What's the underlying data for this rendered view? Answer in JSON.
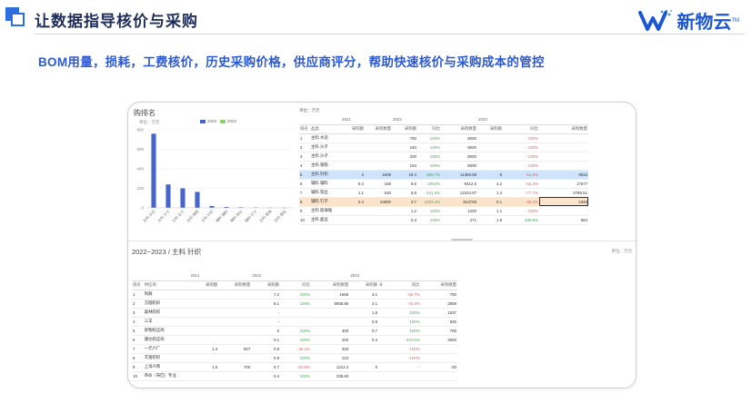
{
  "header": {
    "title": "让数据指导核价与采购",
    "subtitle": "BOM用量，损耗，工费核价，历史采购价格，供应商评分，帮助快速核价与采购成本的管控",
    "brand": "新物云",
    "brand_tm": "TM",
    "colors": {
      "accent": "#2b59d6",
      "title": "#1f2d5a"
    }
  },
  "panel_chart": {
    "title": "购排名",
    "unit": "单位：万元",
    "legend": [
      "2020",
      "2023"
    ]
  },
  "chart_data": {
    "type": "bar",
    "yticks": [
      "800",
      "600",
      "400",
      "200",
      "0"
    ],
    "ylim": [
      0,
      800
    ],
    "categories": [
      "主料.水泥",
      "主料.沙子",
      "主料.石子",
      "主料.钢筋",
      "主料.针织",
      "辅料.辅料",
      "辅料.铁丝",
      "辅料.钉子",
      "主料.玻璃",
      "主料.面盆"
    ],
    "series": [
      {
        "name": "2020",
        "color": "#4766c9",
        "values": [
          760,
          240,
          200,
          164,
          19,
          9,
          6,
          4,
          2,
          1
        ]
      },
      {
        "name": "2023",
        "color": "#8fd16a",
        "values": [
          0,
          0,
          0,
          0,
          0,
          0,
          0,
          0,
          0,
          0
        ]
      }
    ]
  },
  "table_top": {
    "unit": "单位：万元",
    "years": [
      "2021",
      "2022",
      "2023"
    ],
    "headers": [
      "排名",
      "品类",
      "采购额",
      "采购数量",
      "采购额",
      "同比",
      "采购数量",
      "采购额",
      "同比",
      "采购数量"
    ],
    "rows": [
      [
        "1",
        "主料.水泥",
        "",
        "",
        "760",
        "100%",
        "8000",
        "",
        "-100%",
        ""
      ],
      [
        "2",
        "主料.沙子",
        "",
        "",
        "240",
        "100%",
        "8000",
        "",
        "-100%",
        ""
      ],
      [
        "3",
        "主料.沙子",
        "",
        "",
        "200",
        "100%",
        "8000",
        "",
        "-100%",
        ""
      ],
      [
        "4",
        "主料.钢筋",
        "",
        "",
        "164",
        "100%",
        "8000",
        "",
        "-100%",
        ""
      ],
      [
        "5",
        "主料.针织",
        "3",
        "1609",
        "19.4",
        "590.7%",
        "11359.08",
        "9",
        "-51.6%",
        "9533"
      ],
      [
        "6",
        "辅料.辅料",
        "0.4",
        "158",
        "8.9",
        "2062%",
        "9312.6",
        "4.2",
        "-53.3%",
        "17677"
      ],
      [
        "7",
        "辅料.铁丝",
        "1.1",
        "530",
        "5.8",
        "441.5%",
        "13104.07",
        "1.3",
        "-77.7%",
        "3785.51"
      ],
      [
        "8",
        "辅料.钉子",
        "0.4",
        "10800",
        "3.7",
        "1003.4%",
        "913795",
        "0.1",
        "-96.3%",
        "2345"
      ],
      [
        "9",
        "主料.玻璃瓶",
        "",
        "",
        "1.2",
        "100%",
        "1200",
        "1.1",
        "-100%",
        ""
      ],
      [
        "10",
        "主料.面盆",
        "",
        "",
        "0.3",
        "100%",
        "271",
        "1.8",
        "499.8%",
        "564"
      ]
    ]
  },
  "section2": {
    "title": "2022~2023 / 主料.针织",
    "unit": "单位：万元"
  },
  "table_bottom": {
    "years": [
      "2021",
      "2022",
      "2023"
    ],
    "headers": [
      "排名",
      "供应商",
      "采购额",
      "采购数量",
      "采购额",
      "同比",
      "采购数量",
      "采购额",
      "采购数量",
      "同比",
      "采购数量"
    ],
    "rows": [
      [
        "1",
        "利群",
        "",
        "",
        "7.2",
        "100%",
        "1669",
        "3.1",
        "-56.7%",
        "750"
      ],
      [
        "2",
        "方圆纺织",
        "",
        "",
        "8.1",
        "100%",
        "8058.85",
        "2.1",
        "-76.3%",
        "2808"
      ],
      [
        "3",
        "森林纺织",
        "",
        "",
        "-",
        "",
        "",
        "1.8",
        "100%",
        "1537"
      ],
      [
        "4",
        "三羊",
        "",
        "",
        "-",
        "",
        "",
        "0.9",
        "100%",
        "825"
      ],
      [
        "5",
        "新物纺应商",
        "",
        "",
        "0",
        "100%",
        "400",
        "0.7",
        "100%",
        "700"
      ],
      [
        "6",
        "康达纺应商",
        "",
        "",
        "0.1",
        "100%",
        "202",
        "0.4",
        "372.5%",
        "2500"
      ],
      [
        "7",
        "一元六厂",
        "1.4",
        "827",
        "0.8",
        "-45.2%",
        "333",
        "",
        "-100%",
        ""
      ],
      [
        "8",
        "丰富纺织",
        "",
        "",
        "0.8",
        "100%",
        "210",
        "",
        "-100%",
        ""
      ],
      [
        "9",
        "上海众和",
        "1.6",
        "700",
        "0.7",
        "-53.8%",
        "1212.2",
        "0",
        "-",
        "-20"
      ],
      [
        "10",
        "革命（布匹）专业",
        "",
        "",
        "0.4",
        "100%",
        "235.83",
        "",
        "",
        ""
      ]
    ]
  }
}
